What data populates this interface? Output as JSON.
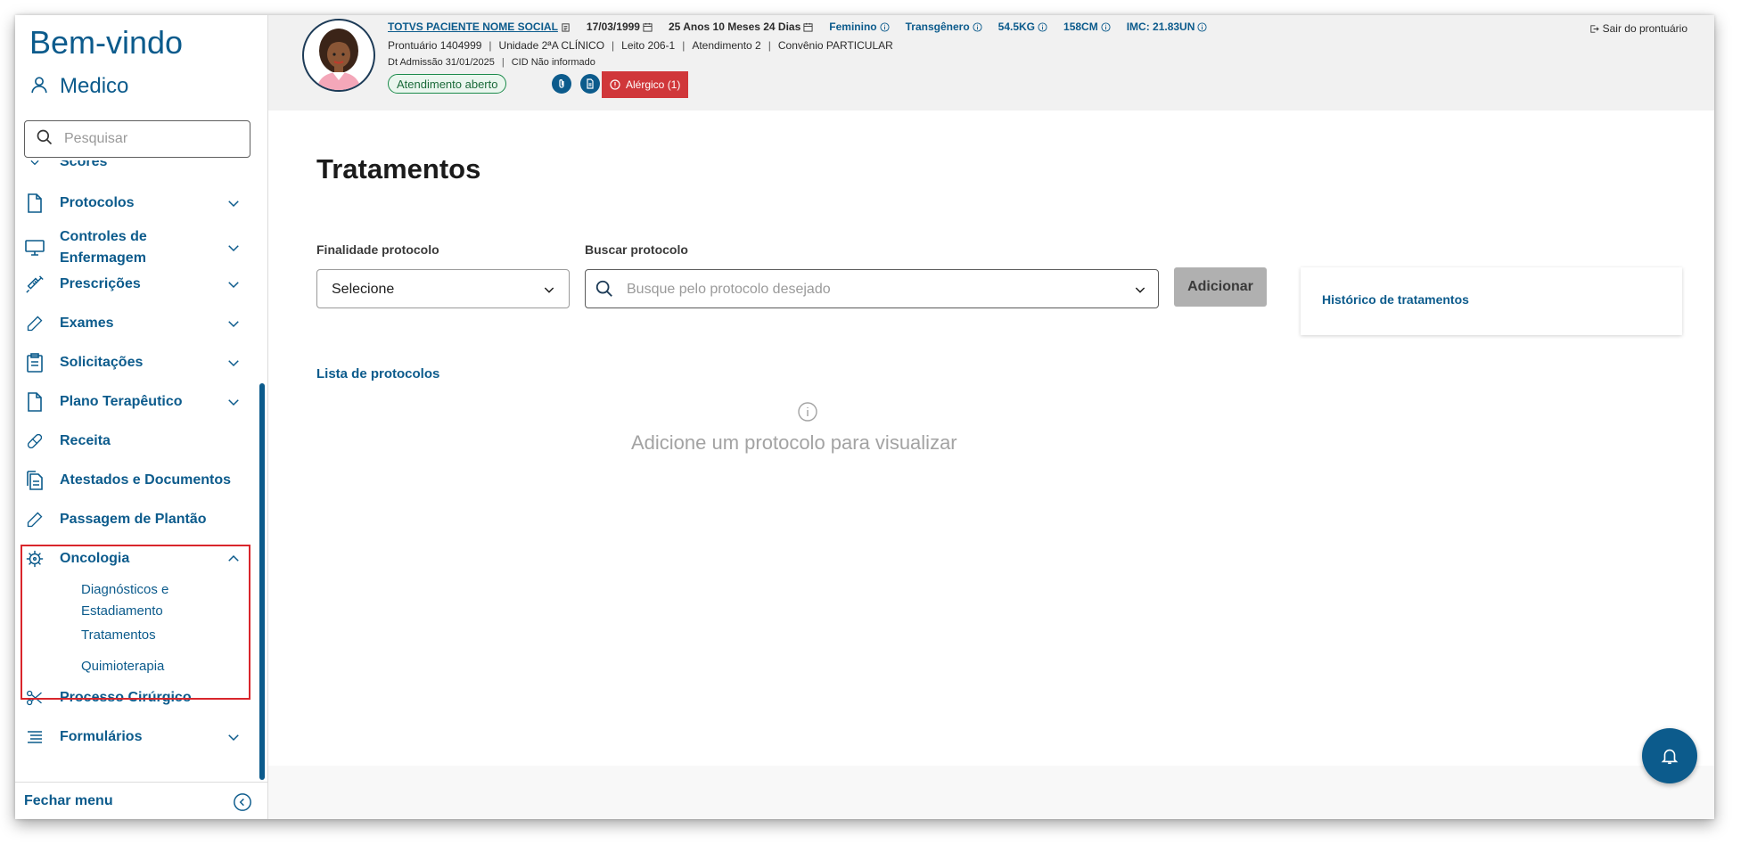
{
  "sidebar": {
    "welcome": "Bem-vindo",
    "user": "Medico",
    "search_placeholder": "Pesquisar",
    "items": [
      {
        "label": "Scores",
        "icon": "chevron-down-icon"
      },
      {
        "label": "Protocolos",
        "icon": "document-icon"
      },
      {
        "label": "Controles de Enfermagem",
        "icon": "monitor-icon"
      },
      {
        "label": "Prescrições",
        "icon": "syringe-icon"
      },
      {
        "label": "Exames",
        "icon": "pencil-icon"
      },
      {
        "label": "Solicitações",
        "icon": "clipboard-icon"
      },
      {
        "label": "Plano Terapêutico",
        "icon": "document-icon"
      },
      {
        "label": "Receita",
        "icon": "pill-icon"
      },
      {
        "label": "Atestados e Documentos",
        "icon": "documents-icon"
      },
      {
        "label": "Passagem de Plantão",
        "icon": "pencil-icon"
      },
      {
        "label": "Oncologia",
        "icon": "virus-icon"
      },
      {
        "label": "Processo Cirúrgico",
        "icon": "scissors-icon"
      },
      {
        "label": "Formulários",
        "icon": "list-icon"
      }
    ],
    "oncologia_sub": [
      "Diagnósticos e Estadiamento",
      "Tratamentos",
      "Quimioterapia"
    ],
    "close_menu": "Fechar menu"
  },
  "header": {
    "patient_name": "TOTVS PACIENTE NOME SOCIAL",
    "birth_date": "17/03/1999",
    "age": "25 Anos 10 Meses 24 Dias",
    "gender": "Feminino",
    "identity": "Transgênero",
    "weight": "54.5KG",
    "height": "158CM",
    "bmi": "IMC: 21.83UN",
    "row2": [
      "Prontuário 1404999",
      "Unidade 2ªA CLÍNICO",
      "Leito 206-1",
      "Atendimento 2",
      "Convênio PARTICULAR"
    ],
    "row3": [
      "Dt Admissão 31/01/2025",
      "CID Não informado"
    ],
    "status_badge": "Atendimento aberto",
    "allergy": "Alérgico (1)",
    "logout": "Sair do prontuário"
  },
  "main": {
    "title": "Tratamentos",
    "finalidade_label": "Finalidade protocolo",
    "finalidade_value": "Selecione",
    "buscar_label": "Buscar protocolo",
    "buscar_placeholder": "Busque pelo protocolo desejado",
    "add_button": "Adicionar",
    "history_link": "Histórico de tratamentos",
    "list_label": "Lista de protocolos",
    "empty_message": "Adicione um protocolo para visualizar"
  },
  "colors": {
    "brand": "#0c5b8c",
    "allergy": "#d0373a",
    "highlight_border": "#d9262c",
    "status_green": "#1b8a4a"
  }
}
